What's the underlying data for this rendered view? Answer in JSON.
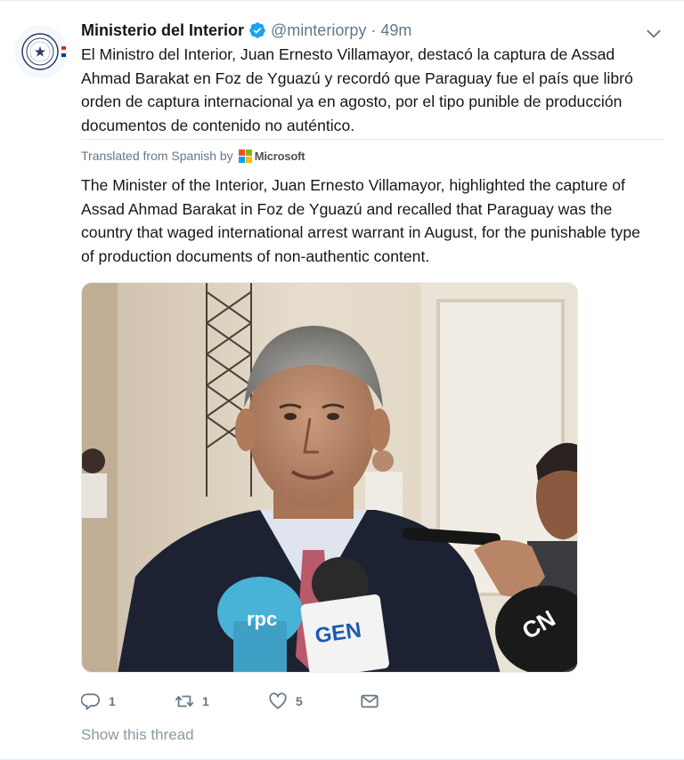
{
  "tweet": {
    "author_name": "Ministerio del Interior",
    "handle": "@minteriorpy",
    "separator": "·",
    "time": "49m",
    "text_original_lines": [
      "El Ministro del Interior, Juan Ernesto Villamayor, destacó la captura de Assad",
      "Ahmad Barakat en Foz de Yguazú y recordó que Paraguay fue el país que libró",
      "orden de captura internacional ya en agosto, por el tipo punible de producción",
      "documentos de contenido no auténtico."
    ],
    "translated_label": "Translated from Spanish by",
    "translator": "Microsoft",
    "text_translated_lines": [
      "The Minister of the Interior, Juan Ernesto Villamayor, highlighted the capture of",
      "Assad Ahmad Barakat in Foz de Yguazú and recalled that Paraguay was the",
      "country that waged international arrest warrant in August, for the punishable type",
      "of production documents of non-authentic content."
    ],
    "media_mic_labels": [
      "rpc",
      "GEN",
      "CN"
    ]
  },
  "actions": {
    "reply_count": "1",
    "retweet_count": "1",
    "like_count": "5"
  },
  "footer": {
    "show_thread": "Show this thread"
  },
  "icons": {
    "verified": "verified-badge-icon",
    "caret": "chevron-down-icon",
    "reply": "reply-icon",
    "retweet": "retweet-icon",
    "like": "heart-icon",
    "dm": "envelope-icon"
  },
  "colors": {
    "verified": "#1da1f2",
    "muted": "#657786",
    "link_muted": "#8899a6",
    "border": "#e6ecf0",
    "text": "#14171a"
  }
}
